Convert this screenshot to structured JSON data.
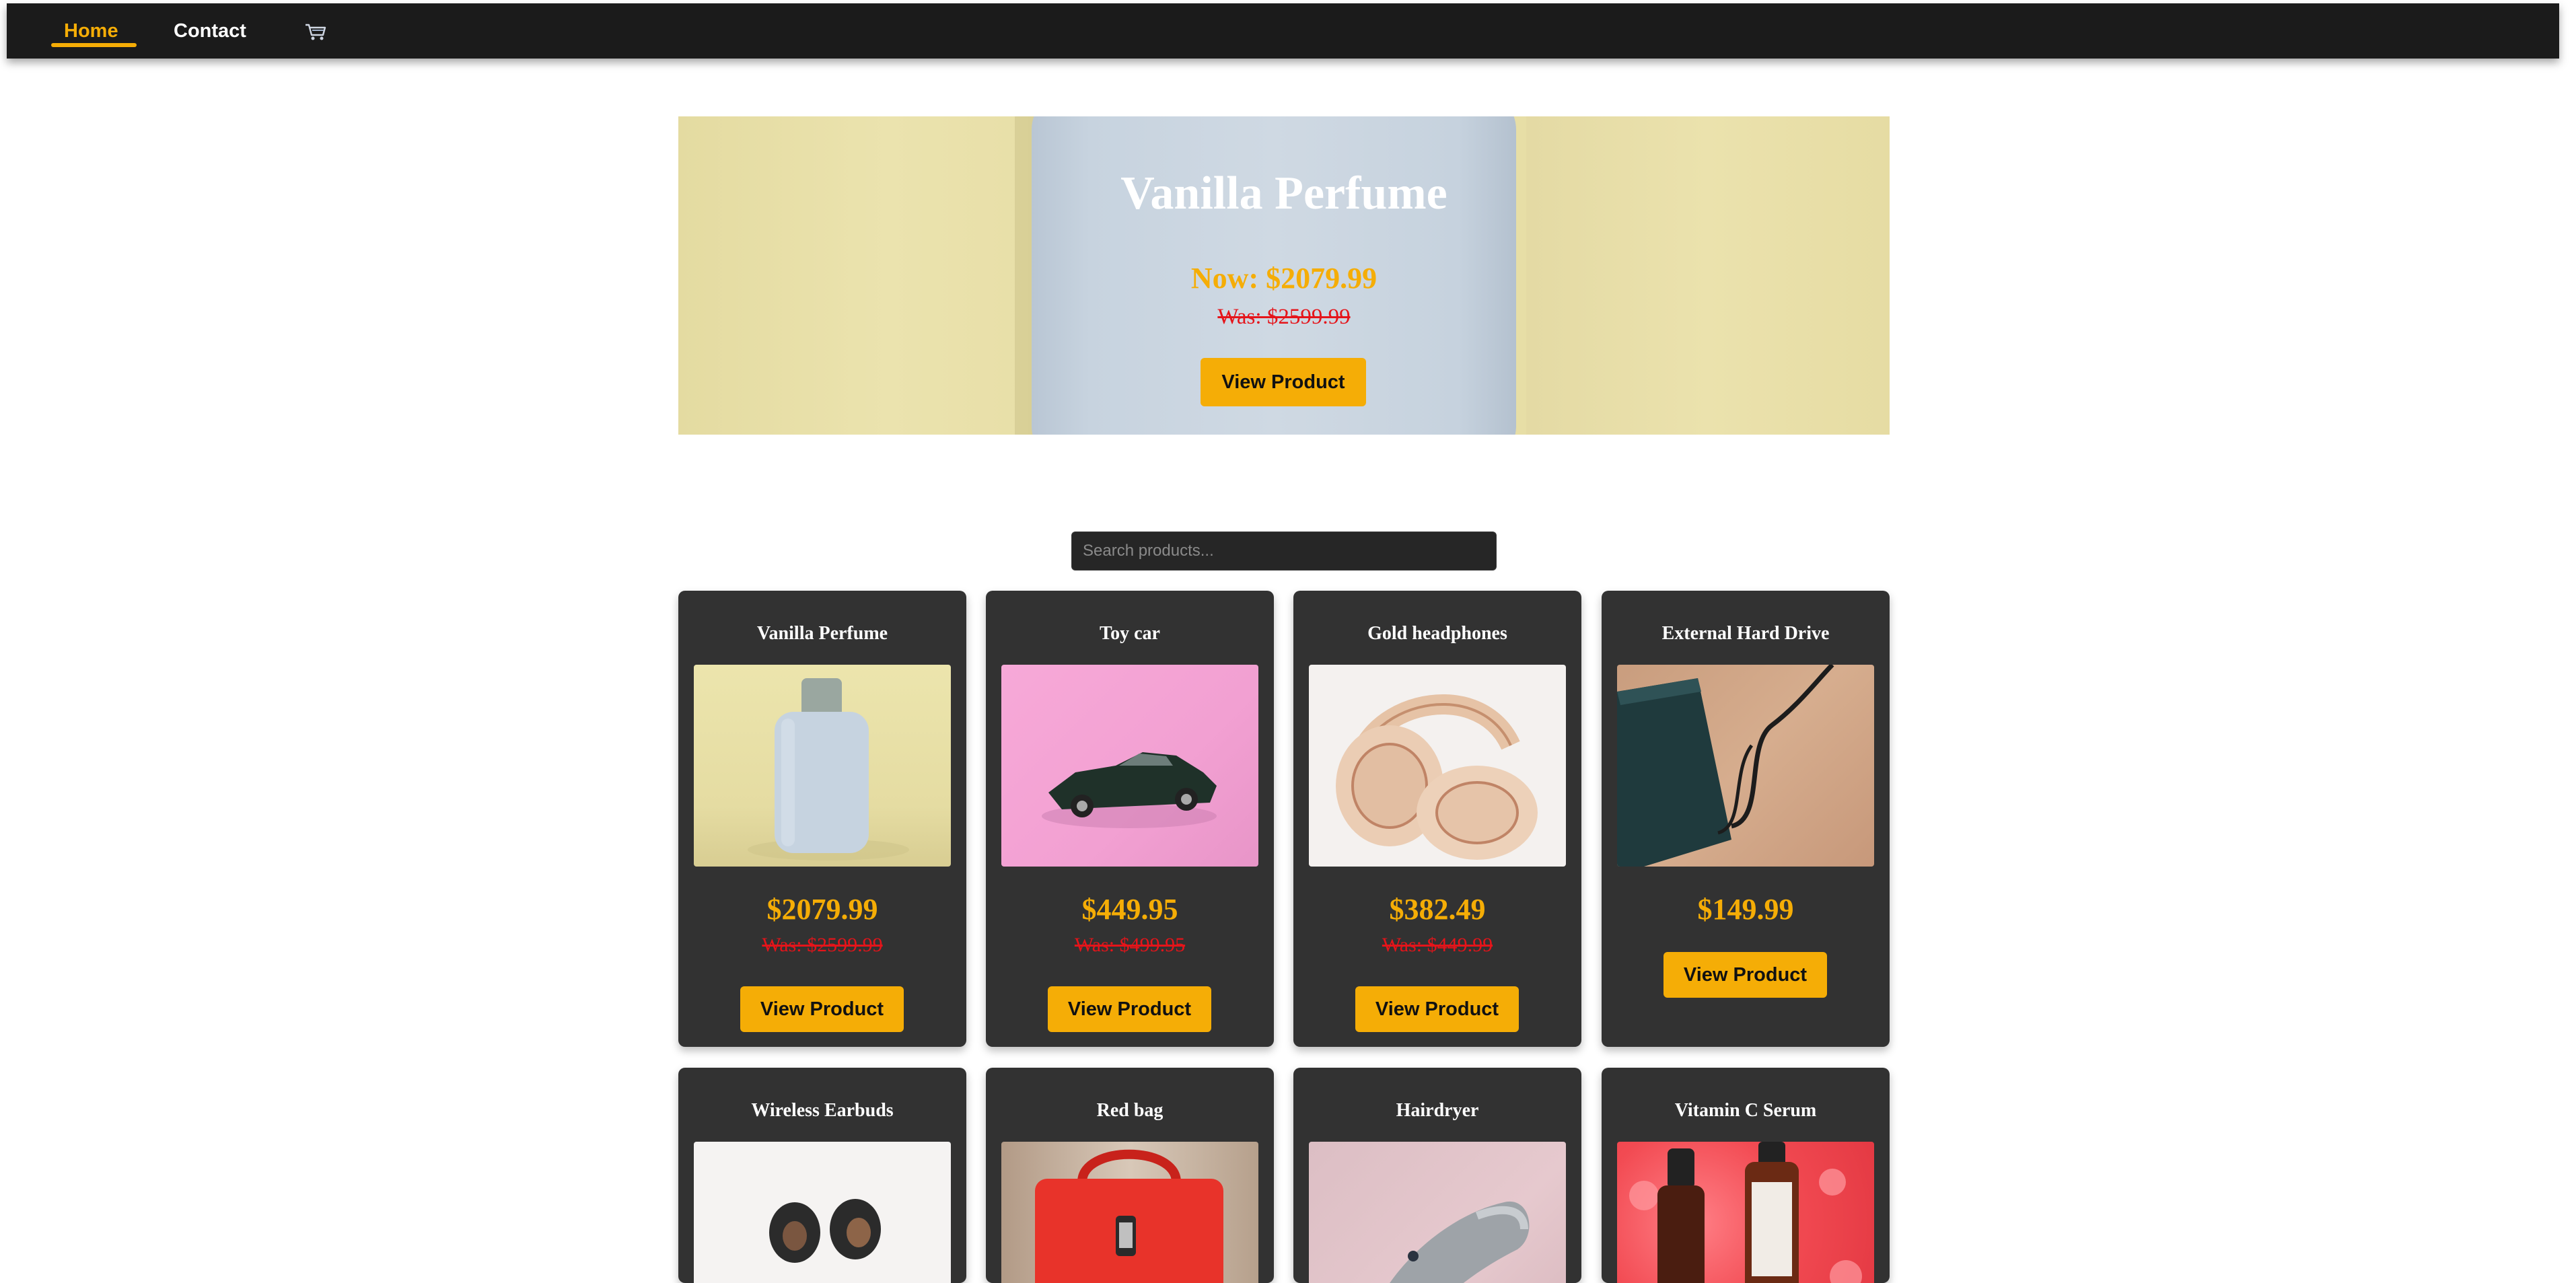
{
  "nav": {
    "home_label": "Home",
    "contact_label": "Contact",
    "cart_icon": "cart-icon",
    "accent": "#f5ad06"
  },
  "hero": {
    "title": "Vanilla Perfume",
    "now_price": "Now: $2079.99",
    "was_price": "Was: $2599.99",
    "button_label": "View Product"
  },
  "search": {
    "placeholder": "Search products..."
  },
  "products": [
    {
      "title": "Vanilla Perfume",
      "price": "$2079.99",
      "was": "Was: $2599.99",
      "button_label": "View Product"
    },
    {
      "title": "Toy car",
      "price": "$449.95",
      "was": "Was: $499.95",
      "button_label": "View Product"
    },
    {
      "title": "Gold headphones",
      "price": "$382.49",
      "was": "Was: $449.99",
      "button_label": "View Product"
    },
    {
      "title": "External Hard Drive",
      "price": "$149.99",
      "was": "",
      "button_label": "View Product"
    },
    {
      "title": "Wireless Earbuds"
    },
    {
      "title": "Red bag"
    },
    {
      "title": "Hairdryer"
    },
    {
      "title": "Vitamin C Serum"
    }
  ],
  "colors": {
    "navbar": "#1b1b1b",
    "card": "#323232",
    "price": "#f5ad06",
    "old_price": "#e5141a",
    "button": "#f5ad06"
  }
}
